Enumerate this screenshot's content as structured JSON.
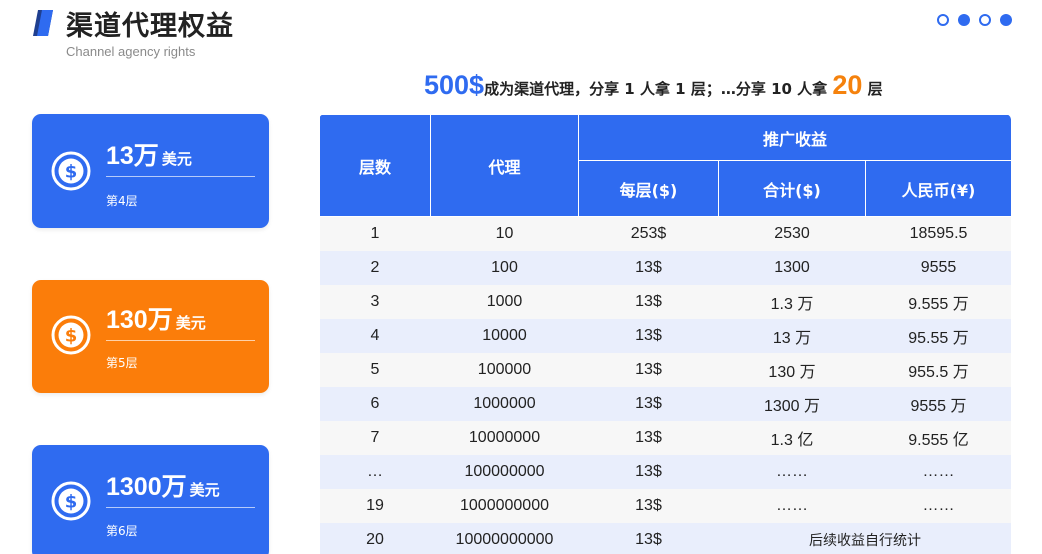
{
  "header": {
    "title": "渠道代理权益",
    "subtitle": "Channel agency rights"
  },
  "pager": {
    "dots": [
      "hollow",
      "filled",
      "hollow",
      "filled"
    ]
  },
  "headline": {
    "price": "500$",
    "text_mid": "成为渠道代理，分享 1 人拿 1 层；…分享 10 人拿 ",
    "highlight": "20",
    "text_end": " 层"
  },
  "cards": [
    {
      "amount": "13万",
      "unit": "美元",
      "level": "第4层",
      "color": "#2f6bf0",
      "icon": "dollar-coin-icon"
    },
    {
      "amount": "130万",
      "unit": "美元",
      "level": "第5层",
      "color": "#fb7d0a",
      "icon": "dollar-coin-icon"
    },
    {
      "amount": "1300万",
      "unit": "美元",
      "level": "第6层",
      "color": "#2f6bf0",
      "icon": "dollar-coin-icon"
    }
  ],
  "table": {
    "headers": {
      "layers": "层数",
      "agents": "代理",
      "income_group": "推广收益",
      "per_layer": "每层($)",
      "total": "合计($)",
      "rmb": "人民币(¥)"
    },
    "rows": [
      {
        "layer": "1",
        "agents": "10",
        "per_layer": "253$",
        "total": "2530",
        "rmb": "18595.5"
      },
      {
        "layer": "2",
        "agents": "100",
        "per_layer": "13$",
        "total": "1300",
        "rmb": "9555"
      },
      {
        "layer": "3",
        "agents": "1000",
        "per_layer": "13$",
        "total": "1.3 万",
        "rmb": "9.555 万"
      },
      {
        "layer": "4",
        "agents": "10000",
        "per_layer": "13$",
        "total": "13 万",
        "rmb": "95.55 万"
      },
      {
        "layer": "5",
        "agents": "100000",
        "per_layer": "13$",
        "total": "130 万",
        "rmb": "955.5 万"
      },
      {
        "layer": "6",
        "agents": "1000000",
        "per_layer": "13$",
        "total": "1300 万",
        "rmb": "9555 万"
      },
      {
        "layer": "7",
        "agents": "10000000",
        "per_layer": "13$",
        "total": "1.3 亿",
        "rmb": "9.555 亿"
      },
      {
        "layer": "…",
        "agents": "100000000",
        "per_layer": "13$",
        "total": "……",
        "rmb": "……"
      },
      {
        "layer": "19",
        "agents": "1000000000",
        "per_layer": "13$",
        "total": "……",
        "rmb": "……"
      },
      {
        "layer": "20",
        "agents": "10000000000",
        "per_layer": "13$",
        "merged_note": "后续收益自行统计"
      }
    ]
  },
  "colors": {
    "accent_blue": "#2f6bf0",
    "accent_orange": "#fb7d0a",
    "row_light": "#f7f7f7",
    "row_tint": "#e9eefc"
  }
}
